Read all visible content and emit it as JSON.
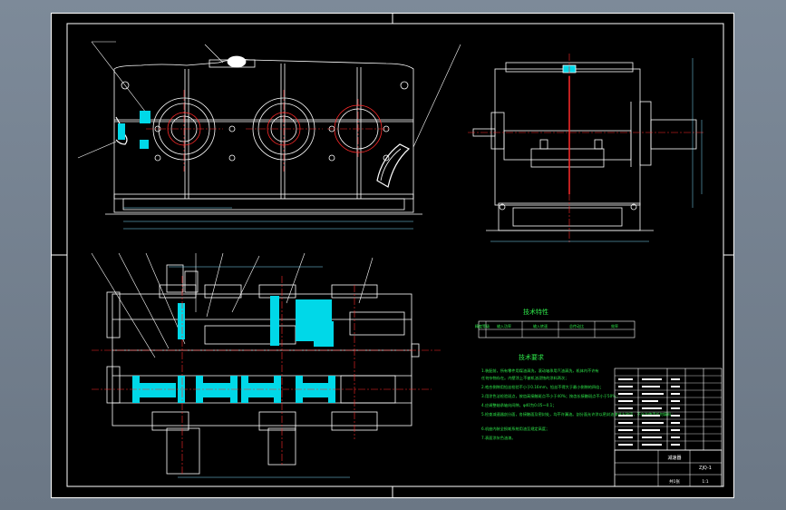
{
  "drawing": {
    "section_tech_data": {
      "title": "技术特性",
      "headers": [
        "输入功率",
        "输入转速",
        "总传动比",
        "效率",
        "精度等级"
      ],
      "values": [
        "",
        "",
        "",
        "",
        ""
      ]
    },
    "section_tech_requirements": {
      "title": "技术要求",
      "lines": [
        "1.装配前，所有零件用煤油清洗，滚动轴承用汽油清洗，机体内不许有",
        "任何杂物存在。内壁涂上不被机油浸蚀的涂料两次；",
        "2.啮合侧隙用铅丝检验不小于0.16mm，铅丝不得大于最小侧隙的四倍；",
        "3.用涂色法检验斑点，按齿高接触斑点不小于40%；按齿长接触斑点不小于50%；",
        "4.应调整轴承轴向间隙，φ40为0.05～0.1；",
        "5.检查减速器剖分面，各接触面及密封处，均不许漏油。剖分面允许涂以密封油漆或水玻璃，不允许使用任何填料；",
        "6.机座内装全损耗系统用油至规定高度；",
        "7.表面涂灰色油漆。"
      ]
    },
    "title_block": {
      "name": "减速器",
      "drawing_no": "ZJQ-1",
      "scale": "1:1",
      "sheet": "共1张"
    }
  },
  "colors": {
    "background": "#000000",
    "line": "#ffffff",
    "center": "#ff2a2a",
    "hatch": "#00d8e8",
    "text": "#2ee84a",
    "dim": "#7fe0ff",
    "frame": "#ffffff"
  }
}
